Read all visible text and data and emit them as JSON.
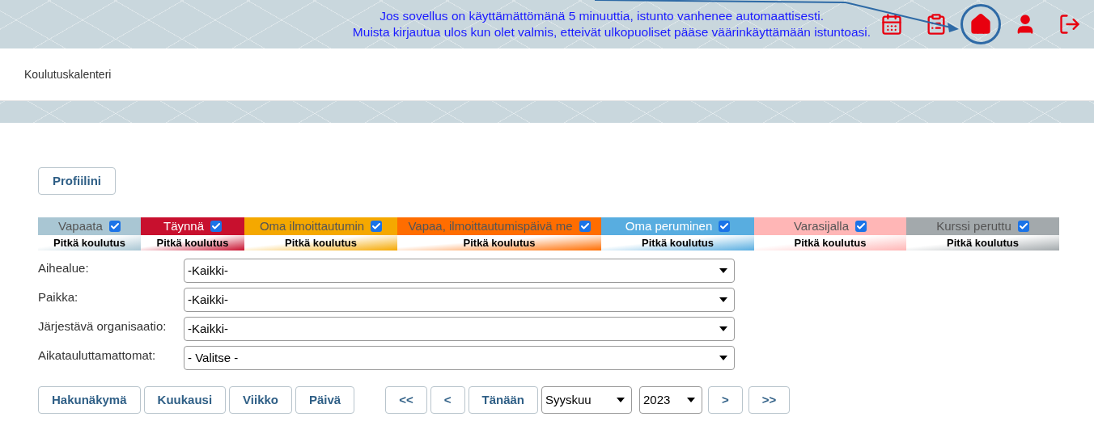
{
  "header": {
    "notice": [
      "Jos sovellus on käyttämättömänä 5 minuuttia, istunto vanhenee automaattisesti.",
      "Muista kirjautua ulos kun olet valmis, etteivät ulkopuoliset pääse väärinkäyttämään istuntoasi."
    ],
    "icons": [
      {
        "kind": "calendar"
      },
      {
        "kind": "list"
      },
      {
        "kind": "home",
        "highlighted": true
      },
      {
        "kind": "user"
      },
      {
        "kind": "logout"
      }
    ]
  },
  "page_title": "Koulutuskalenteri",
  "profile_button": "Profiilini",
  "legend": [
    {
      "label": "Vapaata",
      "checked": true,
      "color": "#a9c6d3",
      "sample": "Pitkä koulutus"
    },
    {
      "label": "Täynnä",
      "checked": true,
      "color": "#c8102e",
      "sample": "Pitkä koulutus"
    },
    {
      "label": "Oma ilmoittautumin",
      "checked": true,
      "color": "#f5a800",
      "sample": "Pitkä koulutus"
    },
    {
      "label": "Vapaa, ilmoittautumispäivä me",
      "checked": true,
      "color": "#ff6d00",
      "sample": "Pitkä koulutus"
    },
    {
      "label": "Oma peruminen",
      "checked": true,
      "color": "#58ade0",
      "sample": "Pitkä koulutus"
    },
    {
      "label": "Varasijalla",
      "checked": true,
      "color": "#ffb6b6",
      "sample": "Pitkä koulutus"
    },
    {
      "label": "Kurssi peruttu",
      "checked": true,
      "color": "#a3a9ac",
      "sample": "Pitkä koulutus"
    }
  ],
  "filters": [
    {
      "label": "Aihealue:",
      "value": "-Kaikki-"
    },
    {
      "label": "Paikka:",
      "value": "-Kaikki-"
    },
    {
      "label": "Järjestävä organisaatio:",
      "value": "-Kaikki-"
    },
    {
      "label": "Aikatauluttamattomat:",
      "value": "- Valitse -"
    }
  ],
  "view_buttons": [
    "Hakunäkymä",
    "Kuukausi",
    "Viikko",
    "Päivä"
  ],
  "nav_buttons_left": [
    "<<",
    "<",
    "Tänään"
  ],
  "month": "Syyskuu",
  "year": "2023",
  "nav_buttons_right": [
    ">",
    ">>"
  ]
}
